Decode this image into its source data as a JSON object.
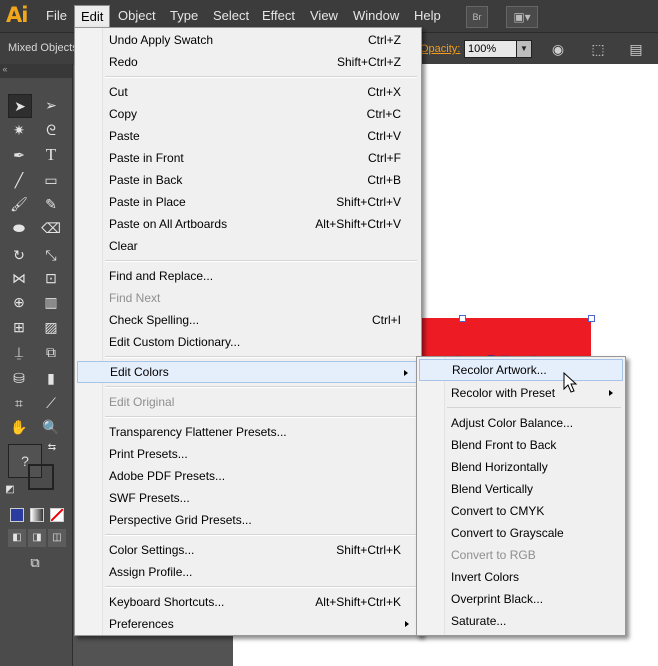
{
  "app": {
    "logo": "Ai"
  },
  "menubar": {
    "items": [
      "File",
      "Edit",
      "Object",
      "Type",
      "Select",
      "Effect",
      "View",
      "Window",
      "Help"
    ],
    "br_label": "Br"
  },
  "control_bar": {
    "selection_label": "Mixed Objects",
    "opacity_label": "Opacity:",
    "opacity_value": "100%"
  },
  "edit_menu": {
    "items": [
      {
        "label": "Undo Apply Swatch",
        "shortcut": "Ctrl+Z"
      },
      {
        "label": "Redo",
        "shortcut": "Shift+Ctrl+Z"
      },
      {
        "label": "Cut",
        "shortcut": "Ctrl+X"
      },
      {
        "label": "Copy",
        "shortcut": "Ctrl+C"
      },
      {
        "label": "Paste",
        "shortcut": "Ctrl+V"
      },
      {
        "label": "Paste in Front",
        "shortcut": "Ctrl+F"
      },
      {
        "label": "Paste in Back",
        "shortcut": "Ctrl+B"
      },
      {
        "label": "Paste in Place",
        "shortcut": "Shift+Ctrl+V"
      },
      {
        "label": "Paste on All Artboards",
        "shortcut": "Alt+Shift+Ctrl+V"
      },
      {
        "label": "Clear",
        "shortcut": ""
      },
      {
        "label": "Find and Replace...",
        "shortcut": ""
      },
      {
        "label": "Find Next",
        "shortcut": "",
        "disabled": true
      },
      {
        "label": "Check Spelling...",
        "shortcut": "Ctrl+I"
      },
      {
        "label": "Edit Custom Dictionary...",
        "shortcut": ""
      },
      {
        "label": "Edit Colors",
        "shortcut": "",
        "submenu": true
      },
      {
        "label": "Edit Original",
        "shortcut": "",
        "disabled": true
      },
      {
        "label": "Transparency Flattener Presets...",
        "shortcut": ""
      },
      {
        "label": "Print Presets...",
        "shortcut": ""
      },
      {
        "label": "Adobe PDF Presets...",
        "shortcut": ""
      },
      {
        "label": "SWF Presets...",
        "shortcut": ""
      },
      {
        "label": "Perspective Grid Presets...",
        "shortcut": ""
      },
      {
        "label": "Color Settings...",
        "shortcut": "Shift+Ctrl+K"
      },
      {
        "label": "Assign Profile...",
        "shortcut": ""
      },
      {
        "label": "Keyboard Shortcuts...",
        "shortcut": "Alt+Shift+Ctrl+K"
      },
      {
        "label": "Preferences",
        "shortcut": "",
        "submenu": true
      }
    ]
  },
  "edit_colors_submenu": {
    "items": [
      {
        "label": "Recolor Artwork..."
      },
      {
        "label": "Recolor with Preset"
      },
      {
        "label": "Adjust Color Balance..."
      },
      {
        "label": "Blend Front to Back"
      },
      {
        "label": "Blend Horizontally"
      },
      {
        "label": "Blend Vertically"
      },
      {
        "label": "Convert to CMYK"
      },
      {
        "label": "Convert to Grayscale"
      },
      {
        "label": "Convert to RGB",
        "disabled": true
      },
      {
        "label": "Invert Colors"
      },
      {
        "label": "Overprint Black..."
      },
      {
        "label": "Saturate..."
      }
    ]
  },
  "tools": {
    "unknown_fill_label": "?"
  },
  "colors": {
    "menubar_bg": "#3c3c3c",
    "menu_bg": "#f0f0f0",
    "highlight": "#e5eefb",
    "art_red": "#ed1c24",
    "art_blue": "#31318a",
    "opacity_orange": "#f29c1f"
  }
}
